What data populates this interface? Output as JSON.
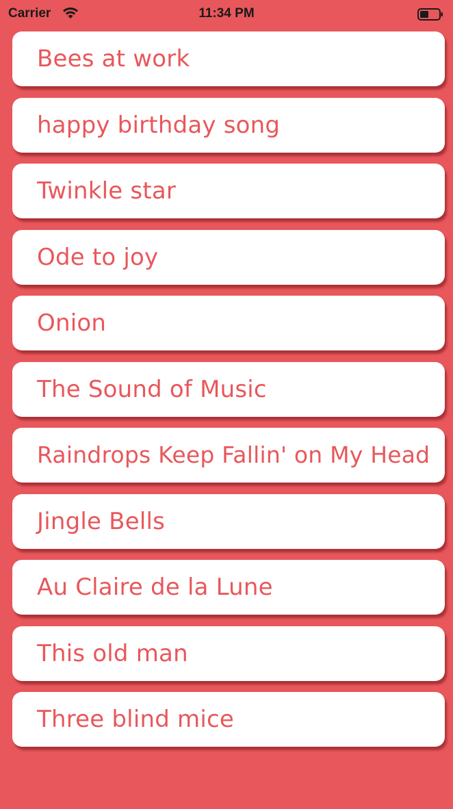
{
  "status_bar": {
    "carrier": "Carrier",
    "time": "11:34 PM",
    "wifi_icon": "wifi-icon",
    "battery_icon": "battery-icon"
  },
  "songs": [
    {
      "label": "Bees at work"
    },
    {
      "label": "happy birthday song"
    },
    {
      "label": "Twinkle star"
    },
    {
      "label": "Ode to joy"
    },
    {
      "label": "Onion"
    },
    {
      "label": "The Sound of Music"
    },
    {
      "label": "Raindrops Keep Fallin' on My Head"
    },
    {
      "label": "Jingle Bells"
    },
    {
      "label": "Au Claire de la Lune"
    },
    {
      "label": "This old man"
    },
    {
      "label": "Three blind mice"
    }
  ],
  "colors": {
    "background": "#e8575b",
    "card": "#ffffff",
    "label": "#e8575b"
  }
}
